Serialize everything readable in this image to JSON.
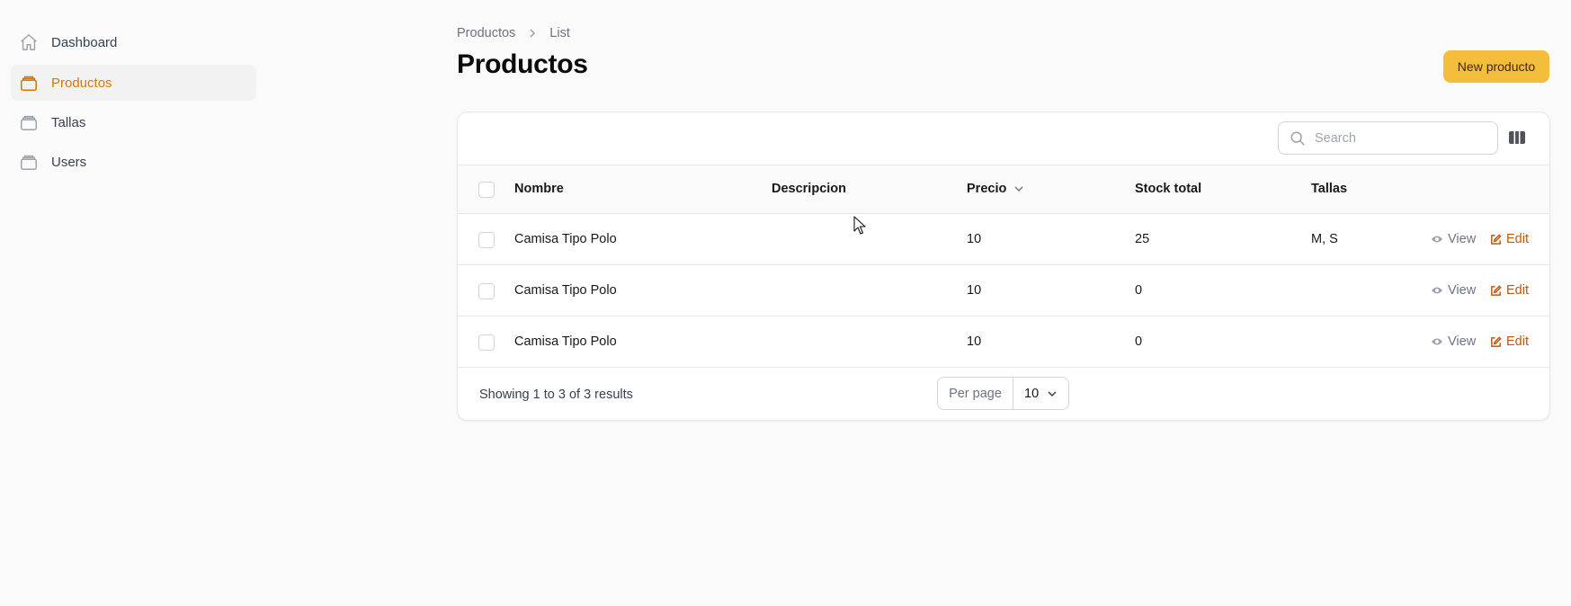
{
  "sidebar": {
    "items": [
      {
        "label": "Dashboard",
        "icon": "home-icon",
        "active": false
      },
      {
        "label": "Productos",
        "icon": "stack-icon",
        "active": true
      },
      {
        "label": "Tallas",
        "icon": "stack-icon",
        "active": false
      },
      {
        "label": "Users",
        "icon": "stack-icon",
        "active": false
      }
    ]
  },
  "breadcrumb": {
    "items": [
      "Productos",
      "List"
    ]
  },
  "header": {
    "title": "Productos",
    "new_button_label": "New producto"
  },
  "colors": {
    "accent": "#f4bd3c",
    "active_nav": "#d97706",
    "edit_link": "#c2570c"
  },
  "table": {
    "search_placeholder": "Search",
    "columns": [
      "Nombre",
      "Descripcion",
      "Precio",
      "Stock total",
      "Tallas"
    ],
    "sorted_column": "Precio",
    "rows": [
      {
        "nombre": "Camisa Tipo Polo",
        "descripcion": "",
        "precio": "10",
        "stock": "25",
        "tallas": "M, S"
      },
      {
        "nombre": "Camisa Tipo Polo",
        "descripcion": "",
        "precio": "10",
        "stock": "0",
        "tallas": ""
      },
      {
        "nombre": "Camisa Tipo Polo",
        "descripcion": "",
        "precio": "10",
        "stock": "0",
        "tallas": ""
      }
    ],
    "view_label": "View",
    "edit_label": "Edit",
    "footer": {
      "summary": "Showing 1 to 3 of 3 results",
      "per_page_label": "Per page",
      "per_page_value": "10"
    }
  }
}
